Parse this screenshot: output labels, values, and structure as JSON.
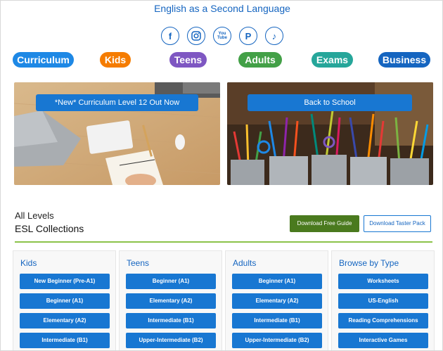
{
  "site_title": "English as a Second Language",
  "social": [
    {
      "icon": "facebook-icon",
      "glyph": "f"
    },
    {
      "icon": "instagram-icon",
      "glyph": ""
    },
    {
      "icon": "youtube-icon",
      "glyph": "You Tube"
    },
    {
      "icon": "pinterest-icon",
      "glyph": "P"
    },
    {
      "icon": "tiktok-icon",
      "glyph": "♪"
    }
  ],
  "categories": [
    {
      "label": "Curriculum",
      "color": "#1e88e5"
    },
    {
      "label": "Kids",
      "color": "#f57c00"
    },
    {
      "label": "Teens",
      "color": "#7e57c2"
    },
    {
      "label": "Adults",
      "color": "#43a047"
    },
    {
      "label": "Exams",
      "color": "#26a69a"
    },
    {
      "label": "Business",
      "color": "#1565c0"
    }
  ],
  "banners": {
    "left_button": "*New* Curriculum Level 12 Out Now",
    "right_button": "Back to School"
  },
  "collections": {
    "level_label": "All Levels",
    "title": "ESL Collections",
    "download_guide": "Download Free Guide",
    "download_taster": "Download Taster Pack"
  },
  "columns": [
    {
      "heading": "Kids",
      "items": [
        "New Beginner (Pre-A1)",
        "Beginner (A1)",
        "Elementary (A2)",
        "Intermediate (B1)"
      ]
    },
    {
      "heading": "Teens",
      "items": [
        "Beginner (A1)",
        "Elementary (A2)",
        "Intermediate (B1)",
        "Upper-Intermediate (B2)"
      ]
    },
    {
      "heading": "Adults",
      "items": [
        "Beginner (A1)",
        "Elementary (A2)",
        "Intermediate (B1)",
        "Upper-Intermediate (B2)"
      ]
    },
    {
      "heading": "Browse by Type",
      "items": [
        "Worksheets",
        "US-English",
        "Reading Comprehensions",
        "Interactive Games"
      ]
    }
  ],
  "colors": {
    "brand_blue": "#1565c0",
    "button_blue": "#1877d2",
    "download_green": "#4a7a1e",
    "divider_green": "#8bc34a"
  }
}
